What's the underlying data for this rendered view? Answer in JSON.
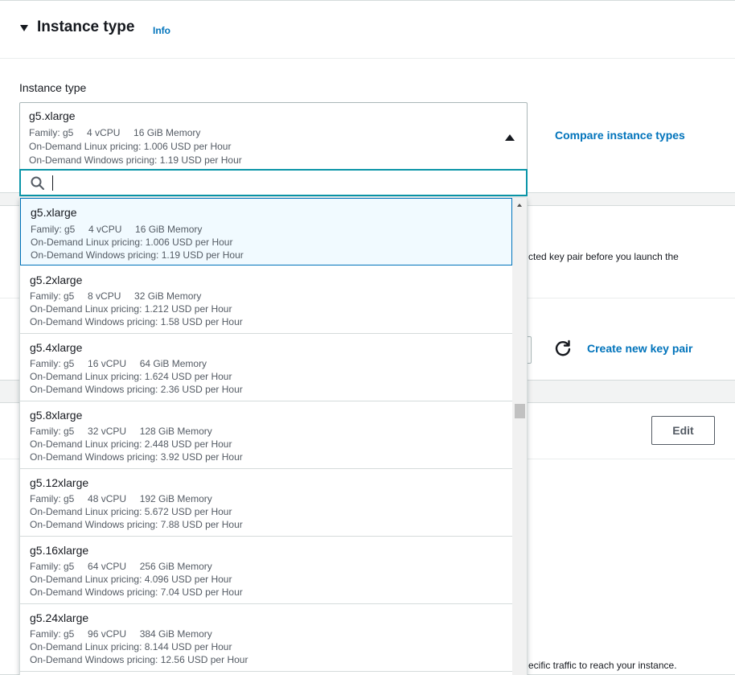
{
  "section": {
    "title": "Instance type",
    "info_link": "Info",
    "field_label": "Instance type",
    "compare_link": "Compare instance types"
  },
  "selected": {
    "name": "g5.xlarge",
    "specs": "Family: g5     4 vCPU     16 GiB Memory",
    "linux": "On-Demand Linux pricing: 1.006 USD per Hour",
    "windows": "On-Demand Windows pricing: 1.19 USD per Hour"
  },
  "search": {
    "value": "",
    "placeholder": ""
  },
  "options": [
    {
      "name": "g5.xlarge",
      "specs": "Family: g5     4 vCPU     16 GiB Memory",
      "linux": "On-Demand Linux pricing: 1.006 USD per Hour",
      "windows": "On-Demand Windows pricing: 1.19 USD per Hour"
    },
    {
      "name": "g5.2xlarge",
      "specs": "Family: g5     8 vCPU     32 GiB Memory",
      "linux": "On-Demand Linux pricing: 1.212 USD per Hour",
      "windows": "On-Demand Windows pricing: 1.58 USD per Hour"
    },
    {
      "name": "g5.4xlarge",
      "specs": "Family: g5     16 vCPU     64 GiB Memory",
      "linux": "On-Demand Linux pricing: 1.624 USD per Hour",
      "windows": "On-Demand Windows pricing: 2.36 USD per Hour"
    },
    {
      "name": "g5.8xlarge",
      "specs": "Family: g5     32 vCPU     128 GiB Memory",
      "linux": "On-Demand Linux pricing: 2.448 USD per Hour",
      "windows": "On-Demand Windows pricing: 3.92 USD per Hour"
    },
    {
      "name": "g5.12xlarge",
      "specs": "Family: g5     48 vCPU     192 GiB Memory",
      "linux": "On-Demand Linux pricing: 5.672 USD per Hour",
      "windows": "On-Demand Windows pricing: 7.88 USD per Hour"
    },
    {
      "name": "g5.16xlarge",
      "specs": "Family: g5     64 vCPU     256 GiB Memory",
      "linux": "On-Demand Linux pricing: 4.096 USD per Hour",
      "windows": "On-Demand Windows pricing: 7.04 USD per Hour"
    },
    {
      "name": "g5.24xlarge",
      "specs": "Family: g5     96 vCPU     384 GiB Memory",
      "linux": "On-Demand Linux pricing: 8.144 USD per Hour",
      "windows": "On-Demand Windows pricing: 12.56 USD per Hour"
    }
  ],
  "background": {
    "keypair_text": "cted key pair before you launch the",
    "create_key_link": "Create new key pair",
    "edit_button": "Edit",
    "security_text": "ecific traffic to reach your instance."
  },
  "colors": {
    "link": "#0073bb",
    "focus_border": "#0a95a8",
    "selected_bg": "#f1faff",
    "text": "#16191f",
    "muted": "#545b64"
  },
  "icons": {
    "section_caret": "caret-down-icon",
    "select_caret": "caret-up-icon",
    "search": "search-icon",
    "refresh": "refresh-icon"
  }
}
